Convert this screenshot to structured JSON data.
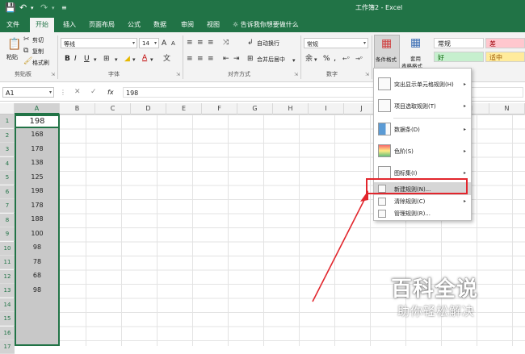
{
  "window": {
    "title": "工作簿2 - Excel",
    "save_icon": "save-icon",
    "undo_icon": "undo-icon",
    "redo_icon": "redo-icon",
    "customize_icon": "customize-icon"
  },
  "tabs": [
    "文件",
    "开始",
    "插入",
    "页面布局",
    "公式",
    "数据",
    "审阅",
    "视图"
  ],
  "active_tab": "开始",
  "tell_me": "告诉我你想要做什么",
  "clipboard": {
    "paste": "粘贴",
    "cut": "剪切",
    "copy": "复制",
    "format_painter": "格式刷",
    "group": "剪贴板"
  },
  "font": {
    "name": "等线",
    "size": "14",
    "bold": "B",
    "italic": "I",
    "underline": "U",
    "grow": "A",
    "shrink": "A",
    "color_letter": "A",
    "group": "字体"
  },
  "alignment": {
    "wrap": "自动换行",
    "merge": "合并后居中",
    "group": "对齐方式"
  },
  "number": {
    "format": "常规",
    "percent": "%",
    "comma": ",",
    "group": "数字"
  },
  "styles": {
    "conditional_formatting": "条件格式",
    "format_as_table_line1": "套用",
    "format_as_table_line2": "表格格式",
    "cells": [
      {
        "label": "常规",
        "bg": "#ffffff",
        "fg": "#222222"
      },
      {
        "label": "差",
        "bg": "#ffc7ce",
        "fg": "#9c0006"
      },
      {
        "label": "好",
        "bg": "#c6efce",
        "fg": "#006100"
      },
      {
        "label": "适中",
        "bg": "#ffeb9c",
        "fg": "#9c5700"
      }
    ]
  },
  "formula_bar": {
    "name_box": "A1",
    "fx": "fx",
    "value": "198"
  },
  "columns": [
    "A",
    "B",
    "C",
    "D",
    "E",
    "F",
    "G",
    "H",
    "I",
    "J",
    "K",
    "L",
    "M",
    "N"
  ],
  "rows": [
    "1",
    "2",
    "3",
    "4",
    "5",
    "6",
    "7",
    "8",
    "9",
    "10",
    "11",
    "12",
    "13",
    "14",
    "15",
    "16",
    "17"
  ],
  "column_a_values": [
    "198",
    "168",
    "178",
    "138",
    "125",
    "198",
    "178",
    "188",
    "100",
    "98",
    "78",
    "68",
    "98"
  ],
  "cf_menu": {
    "items": [
      {
        "label": "突出显示单元格规则(H)",
        "icon": "highlight-rules-icon",
        "submenu": true
      },
      {
        "label": "项目选取规则(T)",
        "icon": "top-bottom-rules-icon",
        "submenu": true
      },
      {
        "label": "数据条(D)",
        "icon": "data-bars-icon",
        "submenu": true
      },
      {
        "label": "色阶(S)",
        "icon": "color-scales-icon",
        "submenu": true
      },
      {
        "label": "图标集(I)",
        "icon": "icon-sets-icon",
        "submenu": true
      },
      {
        "label": "新建规则(N)...",
        "icon": "new-rule-icon",
        "submenu": false
      },
      {
        "label": "清除规则(C)",
        "icon": "clear-rules-icon",
        "submenu": true
      },
      {
        "label": "管理规则(R)...",
        "icon": "manage-rules-icon",
        "submenu": false
      }
    ],
    "highlighted_index": 5
  },
  "watermark": {
    "brand": "百科全说",
    "tagline": "助你轻松解决"
  },
  "colors": {
    "excel_green": "#217346",
    "annotation_red": "#e2262d"
  }
}
